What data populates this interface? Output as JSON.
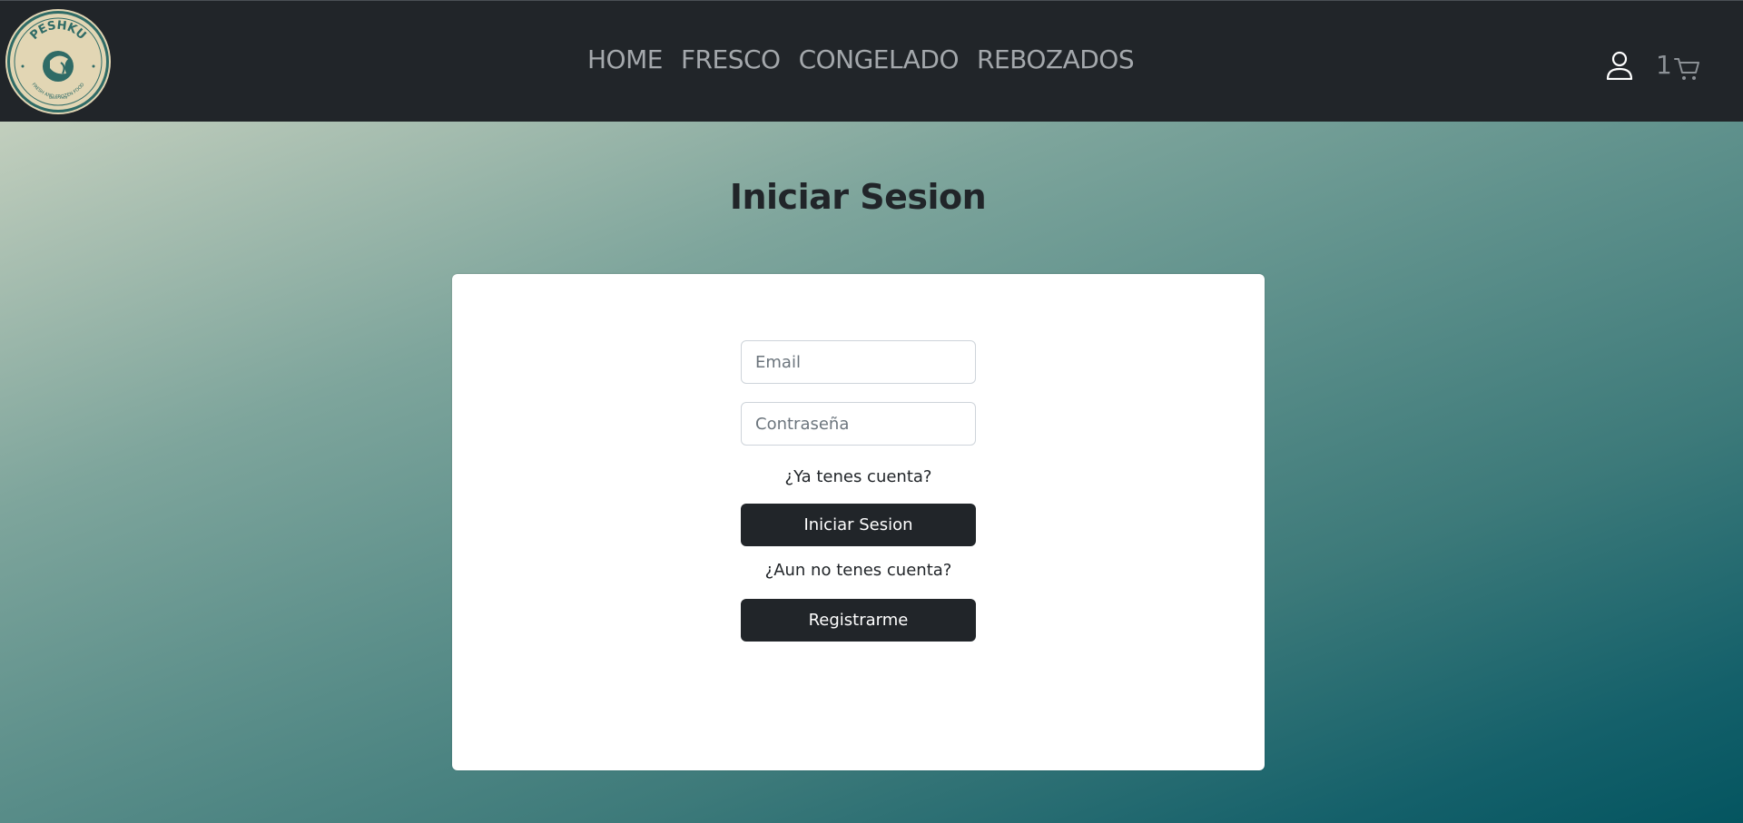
{
  "brand": {
    "logo_text": "PESHKU",
    "logo_subtext": "FRESH AND FROZEN FOOD",
    "logo_since": "SINCE 2019"
  },
  "nav": {
    "links": [
      {
        "label": "HOME"
      },
      {
        "label": "FRESCO"
      },
      {
        "label": "CONGELADO"
      },
      {
        "label": "REBOZADOS"
      }
    ],
    "cart_count": "1"
  },
  "login": {
    "title": "Iniciar Sesion",
    "email_placeholder": "Email",
    "password_placeholder": "Contraseña",
    "have_account_text": "¿Ya tenes cuenta?",
    "login_button": "Iniciar Sesion",
    "no_account_text": "¿Aun no tenes cuenta?",
    "register_button": "Registrarme"
  },
  "colors": {
    "navbar": "#212529",
    "button": "#212529",
    "nav_text": "#a4a8ac",
    "logo_bg": "#e2d6b4",
    "logo_accent": "#2f6b66"
  }
}
